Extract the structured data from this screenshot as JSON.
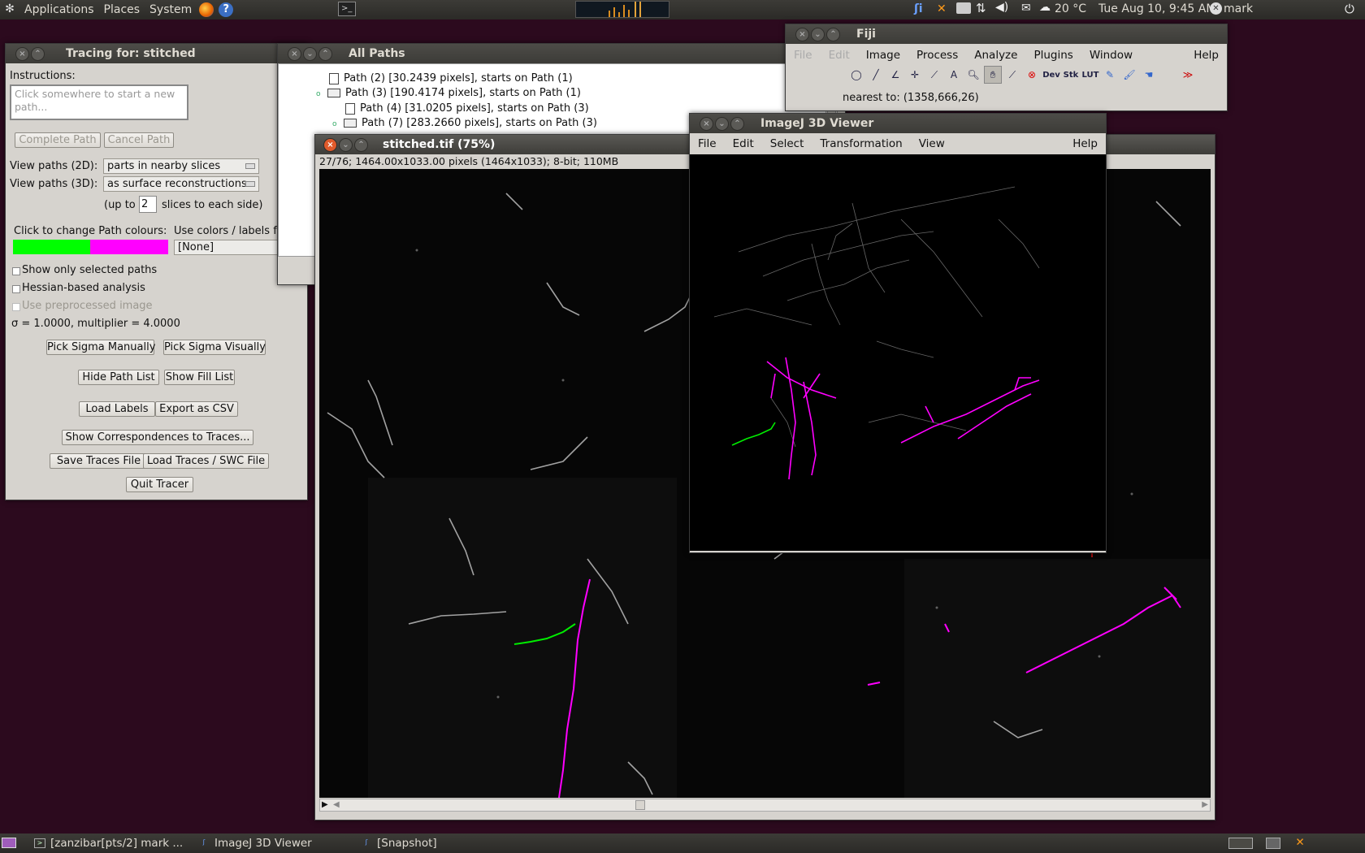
{
  "top_panel": {
    "menus": [
      "Applications",
      "Places",
      "System"
    ],
    "tray": {
      "weather": "20 °C",
      "datetime": "Tue Aug 10,  9:45 AM",
      "user": "mark"
    }
  },
  "tracer": {
    "title": "Tracing for: stitched",
    "instructions_label": "Instructions:",
    "instructions_text": "Click somewhere to start a new path...",
    "complete_path": "Complete Path",
    "cancel_path": "Cancel Path",
    "view2d_label": "View paths (2D):",
    "view2d_value": "parts in nearby slices",
    "view3d_label": "View paths (3D):",
    "view3d_value": "as surface reconstructions",
    "upto_prefix": "(up to",
    "upto_value": "2",
    "upto_suffix": "slices to each side)",
    "colours_label": "Click to change Path colours:",
    "use_colors_label": "Use colors / labels fr",
    "labels_value": "[None]",
    "colors": {
      "selected": "#00ff00",
      "unselected": "#ff00ff"
    },
    "show_selected": "Show only selected paths",
    "hessian": "Hessian-based analysis",
    "preprocessed": "Use preprocessed image",
    "sigma_text": "σ = 1.0000, multiplier = 4.0000",
    "pick_sigma_manually": "Pick Sigma Manually",
    "pick_sigma_visually": "Pick Sigma Visually",
    "hide_path_list": "Hide Path List",
    "show_fill_list": "Show Fill List",
    "load_labels": "Load Labels",
    "export_csv": "Export as CSV",
    "show_correspondences": "Show Correspondences to Traces...",
    "save_traces": "Save Traces File",
    "load_traces": "Load Traces / SWC File",
    "quit": "Quit Tracer"
  },
  "all_paths": {
    "title": "All Paths",
    "rows": [
      "Path (2) [30.2439 pixels], starts on Path (1)",
      "Path (3) [190.4174 pixels], starts on Path (1)",
      "Path (4) [31.0205 pixels], starts on Path (3)",
      "Path (7) [283.2660 pixels], starts on Path (3)"
    ]
  },
  "fiji": {
    "title": "Fiji",
    "menus": [
      "File",
      "Edit",
      "Image",
      "Process",
      "Analyze",
      "Plugins",
      "Window",
      "Help"
    ],
    "tools": [
      "oval-tool",
      "line-tool",
      "angle-tool",
      "point-tool",
      "wand-tool",
      "text-tool",
      "magnifier-tool",
      "hand-tool",
      "dropper-tool",
      "stop-tool",
      "dev-menu",
      "stk-menu",
      "lut-menu",
      "pencil-tool",
      "brush-tool",
      "flood-tool",
      "blank",
      "more-tools"
    ],
    "tool_text": {
      "text": "A",
      "dev": "Dev",
      "stk": "Stk",
      "lut": "LUT",
      "more": "≫"
    },
    "status": "nearest to: (1358,666,26)"
  },
  "viewer3d": {
    "title": "ImageJ 3D Viewer",
    "menus": [
      "File",
      "Edit",
      "Select",
      "Transformation",
      "View"
    ],
    "help": "Help"
  },
  "stitched": {
    "title": "stitched.tif (75%)",
    "info": "27/76; 1464.00x1033.00 pixels (1464x1033); 8-bit; 110MB"
  },
  "taskbar": {
    "items": [
      "[zanzibar[pts/2] mark ...",
      "ImageJ 3D Viewer",
      "[Snapshot]"
    ]
  }
}
